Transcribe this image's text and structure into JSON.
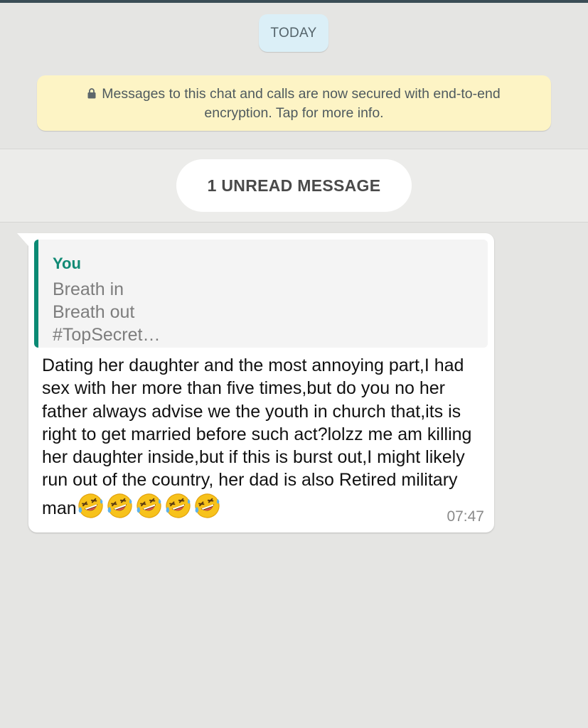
{
  "date_chip": {
    "label": "TODAY"
  },
  "encryption_notice": {
    "icon": "lock-icon",
    "text": "Messages to this chat and calls are now secured with end-to-end encryption. Tap for more info."
  },
  "unread_banner": {
    "label": "1 UNREAD MESSAGE"
  },
  "message": {
    "quote": {
      "author": "You",
      "lines": [
        "Breath in",
        "Breath out",
        "#TopSecret…"
      ]
    },
    "text": "Dating her daughter and the most annoying part,I had sex with her more than five times,but do you no her father always advise we the youth in church that,its is right to get married before such act?lolzz me am killing her daughter inside,but if this is burst out,I might likely run out of the country, her dad is also Retired military man",
    "emoji": {
      "name": "rolling-on-the-floor-laughing-emoji",
      "count": 5
    },
    "time": "07:47"
  },
  "colors": {
    "chat_background": "#e5e5e3",
    "date_chip": "#dbeff7",
    "encryption_notice": "#fdf4c5",
    "quote_accent": "#0b8a74",
    "bubble": "#ffffff"
  }
}
